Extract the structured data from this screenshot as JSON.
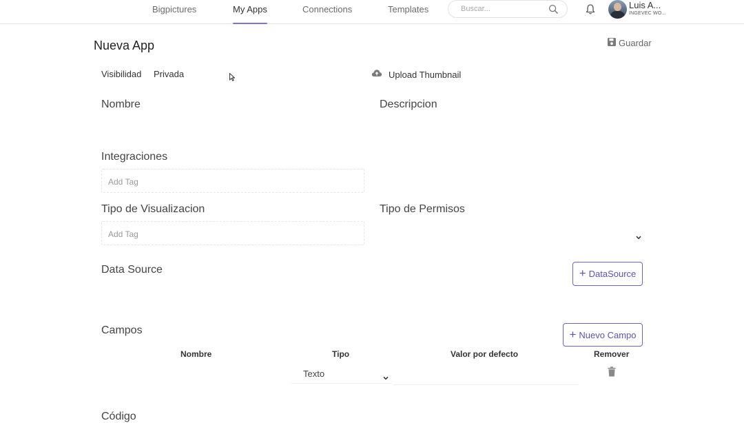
{
  "nav": {
    "tabs": [
      {
        "label": "Bigpictures"
      },
      {
        "label": "My Apps"
      },
      {
        "label": "Connections"
      },
      {
        "label": "Templates"
      }
    ],
    "search_placeholder": "Buscar...",
    "user_name": "Luis A...",
    "user_org": "INGEVEC WO..."
  },
  "page": {
    "title": "Nueva App",
    "save_label": "Guardar",
    "visibility_label": "Visibilidad",
    "visibility_value": "Privada",
    "upload_label": "Upload Thumbnail",
    "name_label": "Nombre",
    "description_label": "Descripcion",
    "integrations_label": "Integraciones",
    "integrations_placeholder": "Add Tag",
    "viz_type_label": "Tipo de Visualizacion",
    "viz_type_placeholder": "Add Tag",
    "perm_type_label": "Tipo de Permisos",
    "datasource_label": "Data Source",
    "datasource_button": "DataSource",
    "fields_label": "Campos",
    "new_field_button": "Nuevo Campo",
    "code_label": "Código"
  },
  "fields_table": {
    "headers": [
      "Nombre",
      "Tipo",
      "Valor por defecto",
      "Remover"
    ],
    "rows": [
      {
        "tipo": "Texto"
      }
    ]
  },
  "colors": {
    "accent": "#6c63c9"
  }
}
